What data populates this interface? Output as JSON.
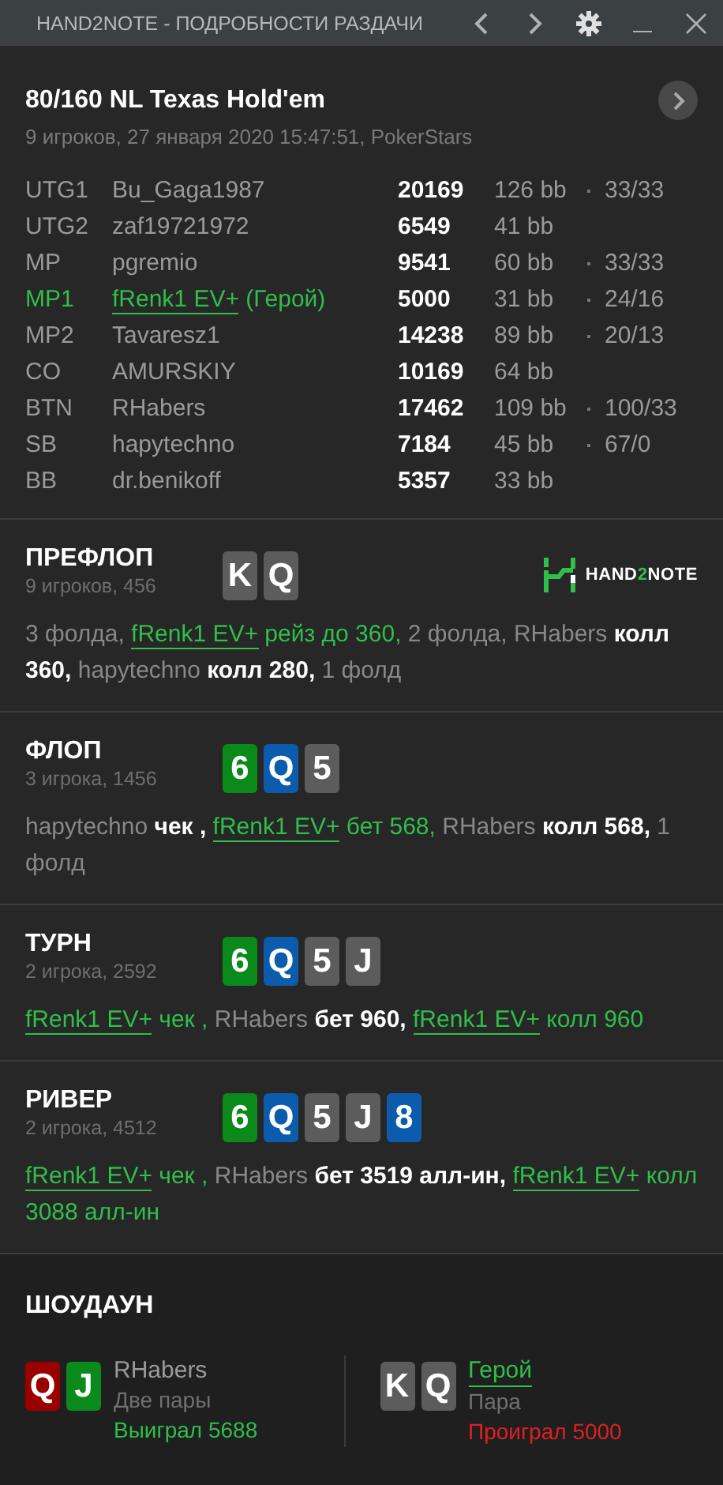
{
  "window": {
    "title": "HAND2NOTE - ПОДРОБНОСТИ РАЗДАЧИ"
  },
  "hand": {
    "title": "80/160 NL Texas Hold'em",
    "subtitle": "9 игроков, 27 января 2020 15:47:51, PokerStars"
  },
  "players": [
    {
      "position": "UTG1",
      "name": "Bu_Gaga1987",
      "stack": "20169",
      "bb": "126 bb",
      "stats": "33/33",
      "hero": false
    },
    {
      "position": "UTG2",
      "name": "zaf19721972",
      "stack": "6549",
      "bb": "41 bb",
      "hero": false
    },
    {
      "position": "MP",
      "name": "pgremio",
      "stack": "9541",
      "bb": "60 bb",
      "stats": "33/33",
      "hero": false
    },
    {
      "position": "MP1",
      "name": "fRenk1 EV+",
      "suffix": "(Герой)",
      "stack": "5000",
      "bb": "31 bb",
      "stats": "24/16",
      "hero": true
    },
    {
      "position": "MP2",
      "name": "Tavaresz1",
      "stack": "14238",
      "bb": "89 bb",
      "stats": "20/13",
      "hero": false
    },
    {
      "position": "CO",
      "name": "AMURSKIY",
      "stack": "10169",
      "bb": "64 bb",
      "hero": false
    },
    {
      "position": "BTN",
      "name": "RHabers",
      "stack": "17462",
      "bb": "109 bb",
      "stats": "100/33",
      "hero": false
    },
    {
      "position": "SB",
      "name": "hapytechno",
      "stack": "7184",
      "bb": "45 bb",
      "stats": "67/0",
      "hero": false
    },
    {
      "position": "BB",
      "name": "dr.benikoff",
      "stack": "5357",
      "bb": "33 bb",
      "hero": false
    }
  ],
  "logo": {
    "text_left": "HAND",
    "text_mid": "2",
    "text_right": "NOTE"
  },
  "streets": [
    {
      "name": "ПРЕФЛОП",
      "info": "9 игроков, 456",
      "cards": [
        {
          "rank": "K",
          "color": "#5c5c5c"
        },
        {
          "rank": "Q",
          "color": "#5c5c5c"
        }
      ],
      "actions": [
        {
          "kind": "muted",
          "text": "3 фолда, "
        },
        {
          "kind": "hero",
          "text": "fRenk1 EV+"
        },
        {
          "kind": "hero_action",
          "text": " рейз до 360, "
        },
        {
          "kind": "muted",
          "text": "2 фолда, RHabers "
        },
        {
          "kind": "action",
          "text": "колл 360, "
        },
        {
          "kind": "muted",
          "text": "hapytechno "
        },
        {
          "kind": "action",
          "text": "колл 280, "
        },
        {
          "kind": "muted",
          "text": "1 фолд"
        }
      ]
    },
    {
      "name": "ФЛОП",
      "info": "3 игрока, 1456",
      "cards": [
        {
          "rank": "6",
          "color": "#0a8a1a"
        },
        {
          "rank": "Q",
          "color": "#0b5cad"
        },
        {
          "rank": "5",
          "color": "#5c5c5c"
        }
      ],
      "actions": [
        {
          "kind": "muted",
          "text": "hapytechno "
        },
        {
          "kind": "action",
          "text": "чек , "
        },
        {
          "kind": "hero",
          "text": "fRenk1 EV+"
        },
        {
          "kind": "hero_action",
          "text": " бет 568, "
        },
        {
          "kind": "muted",
          "text": "RHabers "
        },
        {
          "kind": "action",
          "text": "колл 568, "
        },
        {
          "kind": "muted",
          "text": "1 фолд"
        }
      ]
    },
    {
      "name": "ТУРН",
      "info": "2 игрока, 2592",
      "cards": [
        {
          "rank": "6",
          "color": "#0a8a1a"
        },
        {
          "rank": "Q",
          "color": "#0b5cad"
        },
        {
          "rank": "5",
          "color": "#5c5c5c"
        },
        {
          "rank": "J",
          "color": "#5c5c5c"
        }
      ],
      "actions": [
        {
          "kind": "hero",
          "text": "fRenk1 EV+"
        },
        {
          "kind": "hero_action",
          "text": " чек , "
        },
        {
          "kind": "muted",
          "text": "RHabers "
        },
        {
          "kind": "action",
          "text": "бет 960, "
        },
        {
          "kind": "hero",
          "text": "fRenk1 EV+"
        },
        {
          "kind": "hero_action",
          "text": " колл 960"
        }
      ]
    },
    {
      "name": "РИВЕР",
      "info": "2 игрока, 4512",
      "cards": [
        {
          "rank": "6",
          "color": "#0a8a1a"
        },
        {
          "rank": "Q",
          "color": "#0b5cad"
        },
        {
          "rank": "5",
          "color": "#5c5c5c"
        },
        {
          "rank": "J",
          "color": "#5c5c5c"
        },
        {
          "rank": "8",
          "color": "#0b5cad"
        }
      ],
      "actions": [
        {
          "kind": "hero",
          "text": "fRenk1 EV+"
        },
        {
          "kind": "hero_action",
          "text": " чек , "
        },
        {
          "kind": "muted",
          "text": "RHabers "
        },
        {
          "kind": "action",
          "text": "бет 3519 алл-ин, "
        },
        {
          "kind": "hero",
          "text": "fRenk1 EV+"
        },
        {
          "kind": "hero_action",
          "text": " колл 3088 алл-ин"
        }
      ]
    }
  ],
  "showdown": {
    "title": "ШОУДАУН",
    "hands": [
      {
        "cards": [
          {
            "rank": "Q",
            "color": "#9b0000"
          },
          {
            "rank": "J",
            "color": "#0a8a1a"
          }
        ],
        "player": "RHabers",
        "hero": false,
        "combo": "Две пары",
        "result": "Выиграл 5688",
        "won": true
      },
      {
        "cards": [
          {
            "rank": "K",
            "color": "#5c5c5c"
          },
          {
            "rank": "Q",
            "color": "#5c5c5c"
          }
        ],
        "player": "Герой",
        "hero": true,
        "combo": "Пара",
        "result": "Проиграл 5000",
        "won": false
      }
    ]
  }
}
